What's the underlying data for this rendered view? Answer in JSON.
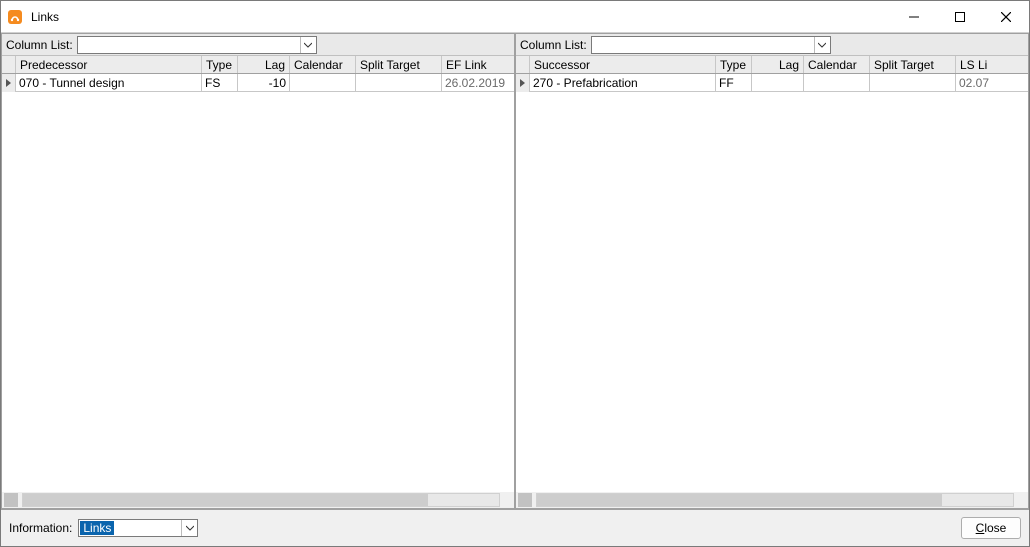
{
  "window": {
    "title": "Links"
  },
  "left": {
    "column_list_label": "Column List:",
    "headers": {
      "name": "Predecessor",
      "type": "Type",
      "lag": "Lag",
      "calendar": "Calendar",
      "split": "Split Target",
      "last": "EF Link"
    },
    "row": {
      "name": "070 - Tunnel design",
      "type": "FS",
      "lag": "-10",
      "calendar": "",
      "split": "",
      "last": "26.02.2019"
    }
  },
  "right": {
    "column_list_label": "Column List:",
    "headers": {
      "name": "Successor",
      "type": "Type",
      "lag": "Lag",
      "calendar": "Calendar",
      "split": "Split Target",
      "last": "LS Li"
    },
    "row": {
      "name": "270 - Prefabrication",
      "type": "FF",
      "lag": "",
      "calendar": "",
      "split": "",
      "last": "02.07"
    }
  },
  "footer": {
    "info_label": "Information:",
    "info_value": "Links",
    "close_label": "Close"
  }
}
